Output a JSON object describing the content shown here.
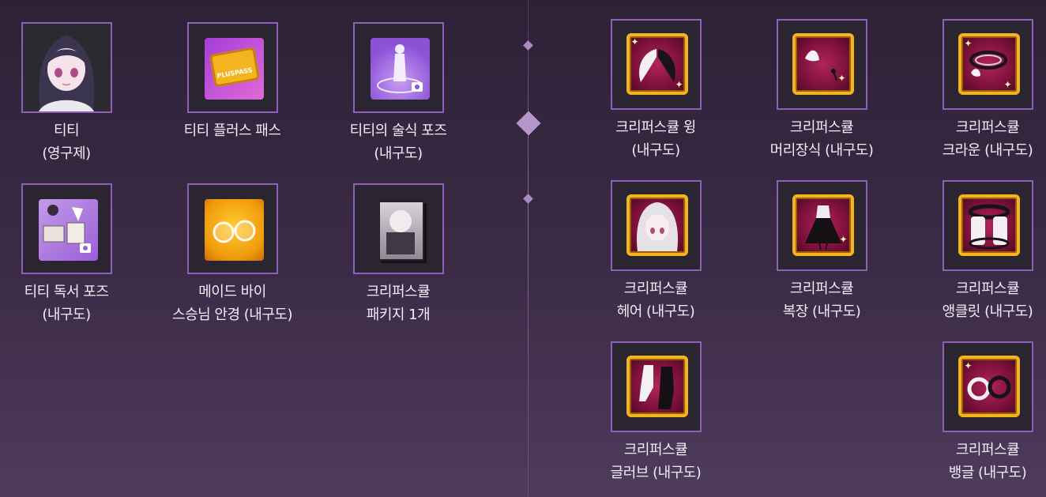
{
  "left_items": [
    {
      "line1": "티티",
      "line2": "(영구제)",
      "icon": "character-portrait-icon"
    },
    {
      "line1": "티티 플러스 패스",
      "line2": "",
      "icon": "plus-pass-ticket-icon",
      "badge": "PLUSPASS"
    },
    {
      "line1": "티티의 술식 포즈",
      "line2": "(내구도)",
      "icon": "spell-pose-card-icon"
    },
    {
      "line1": "티티 독서 포즈",
      "line2": "(내구도)",
      "icon": "reading-pose-card-icon"
    },
    {
      "line1": "메이드 바이",
      "line2": "스승님 안경 (내구도)",
      "icon": "glasses-icon"
    },
    {
      "line1": "크리퍼스큘",
      "line2": "패키지 1개",
      "icon": "package-card-icon"
    }
  ],
  "right_items": [
    {
      "line1": "크리퍼스큘 윙",
      "line2": "(내구도)",
      "icon": "wing-icon"
    },
    {
      "line1": "크리퍼스큘",
      "line2": "머리장식 (내구도)",
      "icon": "hair-ornament-icon"
    },
    {
      "line1": "크리퍼스큘",
      "line2": "크라운 (내구도)",
      "icon": "crown-icon"
    },
    {
      "line1": "크리퍼스큘",
      "line2": "헤어 (내구도)",
      "icon": "hair-icon"
    },
    {
      "line1": "크리퍼스큘",
      "line2": "복장 (내구도)",
      "icon": "outfit-icon"
    },
    {
      "line1": "크리퍼스큘",
      "line2": "앵클릿 (내구도)",
      "icon": "anklet-icon"
    },
    {
      "line1": "크리퍼스큘",
      "line2": "글러브 (내구도)",
      "icon": "glove-icon"
    },
    {
      "line1": "크리퍼스큘",
      "line2": "뱅글 (내구도)",
      "icon": "bangle-icon"
    }
  ],
  "colors": {
    "frame_border": "#8c5fb8",
    "frame_fill": "#2a2530",
    "gold_rim": "#f2b520",
    "tile_red": "#7c103a"
  }
}
